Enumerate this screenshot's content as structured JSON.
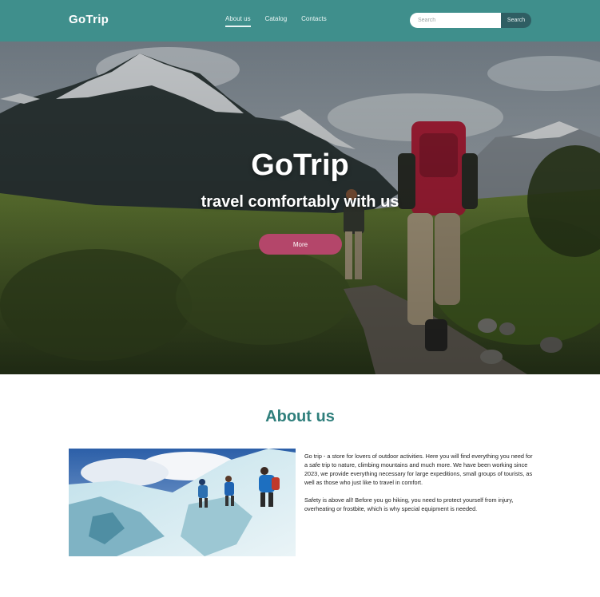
{
  "header": {
    "logo": "GoTrip",
    "nav": [
      {
        "label": "About us",
        "active": true
      },
      {
        "label": "Catalog",
        "active": false
      },
      {
        "label": "Contacts",
        "active": false
      }
    ],
    "search": {
      "placeholder": "Search",
      "button_label": "Search"
    }
  },
  "hero": {
    "title": "GoTrip",
    "subtitle": "travel comfortably with us",
    "more_label": "More"
  },
  "about": {
    "heading": "About us",
    "paragraphs": [
      "Go trip - a store for lovers of outdoor activities. Here you will find everything you need for a safe trip to nature, climbing mountains and much more. We have been working since 2023, we provide everything necessary for large expeditions, small groups of tourists, as well as those who just like to travel in comfort.",
      "Safety is above all! Before you go hiking, you need to protect yourself from injury, overheating or frostbite, which is why special equipment is needed."
    ]
  },
  "colors": {
    "header_bg": "#3f8f8c",
    "search_button": "#2f5e63",
    "more_button": "#b4466a",
    "heading_accent": "#2f7f7c"
  }
}
